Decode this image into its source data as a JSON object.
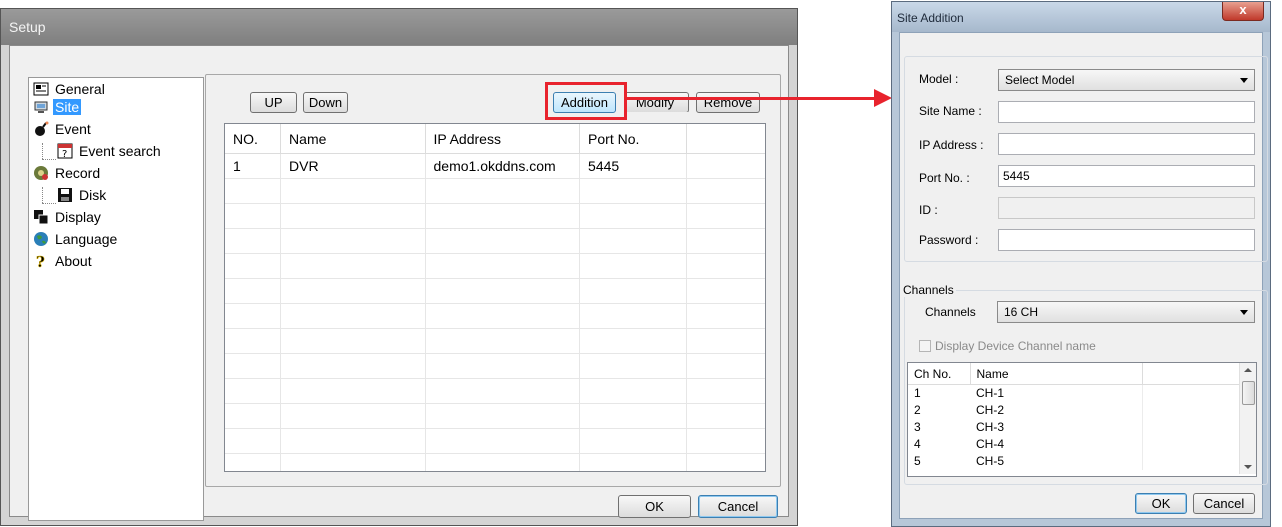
{
  "setup": {
    "title": "Setup",
    "tree": [
      {
        "label": "General",
        "icon": "general-icon"
      },
      {
        "label": "Site",
        "icon": "site-icon",
        "selected": true
      },
      {
        "label": "Event",
        "icon": "event-icon"
      },
      {
        "label": "Event search",
        "icon": "event-search-icon"
      },
      {
        "label": "Record",
        "icon": "record-icon"
      },
      {
        "label": "Disk",
        "icon": "disk-icon"
      },
      {
        "label": "Display",
        "icon": "display-icon"
      },
      {
        "label": "Language",
        "icon": "language-icon"
      },
      {
        "label": "About",
        "icon": "about-icon"
      }
    ],
    "buttons": {
      "up": "UP",
      "down": "Down",
      "addition": "Addition",
      "modify": "Modify",
      "remove": "Remove",
      "ok": "OK",
      "cancel": "Cancel"
    },
    "columns": [
      "NO.",
      "Name",
      "IP Address",
      "Port No."
    ],
    "rows": [
      [
        "1",
        "DVR",
        "demo1.okddns.com",
        "5445"
      ]
    ]
  },
  "dialog": {
    "title": "Site Addition",
    "close": "x",
    "fields": {
      "model_label": "Model :",
      "model_value": "Select Model",
      "site_name_label": "Site Name :",
      "site_name_value": "",
      "ip_label": "IP Address :",
      "ip_value": "",
      "port_label": "Port No. :",
      "port_value": "5445",
      "id_label": "ID :",
      "id_value": "",
      "password_label": "Password :",
      "password_value": ""
    },
    "channels_group": "Channels",
    "channels_label": "Channels",
    "channels_value": "16 CH",
    "display_channel_name": "Display Device Channel name",
    "channel_columns": [
      "Ch No.",
      "Name"
    ],
    "channel_rows": [
      [
        "1",
        "CH-1"
      ],
      [
        "2",
        "CH-2"
      ],
      [
        "3",
        "CH-3"
      ],
      [
        "4",
        "CH-4"
      ],
      [
        "5",
        "CH-5"
      ]
    ],
    "ok": "OK",
    "cancel": "Cancel"
  },
  "colors": {
    "callout": "#e8232d",
    "selection": "#3399ff"
  }
}
